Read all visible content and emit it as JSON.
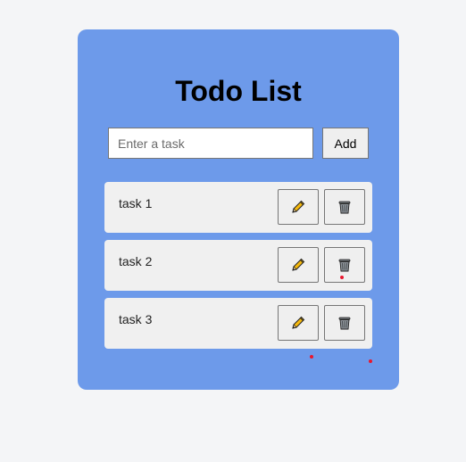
{
  "header": {
    "title": "Todo List"
  },
  "new_task": {
    "placeholder": "Enter a task",
    "value": "",
    "add_label": "Add"
  },
  "tasks": [
    {
      "text": "task 1",
      "edit_icon": "pencil-icon",
      "delete_icon": "trash-icon"
    },
    {
      "text": "task 2",
      "edit_icon": "pencil-icon",
      "delete_icon": "trash-icon"
    },
    {
      "text": "task 3",
      "edit_icon": "pencil-icon",
      "delete_icon": "trash-icon"
    }
  ],
  "colors": {
    "page_background": "#f4f5f7",
    "card_background": "#6d9aea",
    "task_background": "#f0f0f0",
    "marker": "#e8172e"
  }
}
